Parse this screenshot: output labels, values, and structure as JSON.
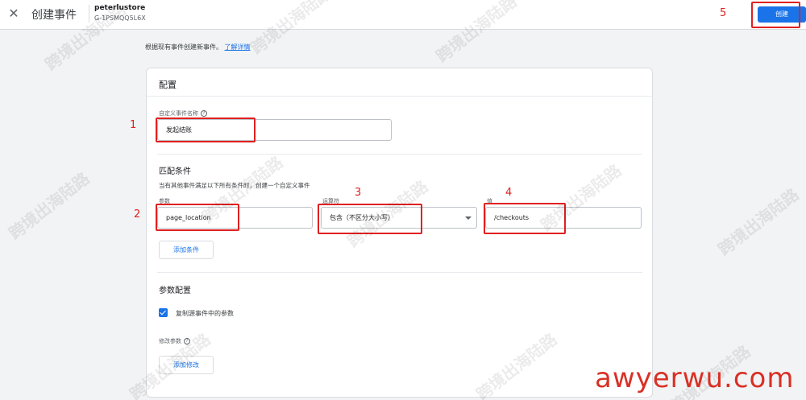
{
  "topbar": {
    "close_icon": "close-icon",
    "title": "创建事件",
    "property_name": "peterlustore",
    "property_id": "G-1PSMQQ5L6X",
    "create_label": "创建"
  },
  "intro": {
    "text": "根据现有事件创建新事件。",
    "link": "了解详情"
  },
  "config": {
    "title": "配置",
    "event_name_label": "自定义事件名称",
    "event_name_value": "发起结账"
  },
  "match": {
    "title": "匹配条件",
    "description": "当有其他事件满足以下所有条件时，创建一个自定义事件",
    "param_label": "参数",
    "param_value": "page_location",
    "operator_label": "运算符",
    "operator_value": "包含（不区分大小写）",
    "value_label": "值",
    "value_value": "/checkouts",
    "add_condition_label": "添加条件"
  },
  "param_config": {
    "title": "参数配置",
    "copy_params_label": "复制源事件中的参数",
    "copy_params_checked": true,
    "modify_params_label": "修改参数",
    "add_modify_label": "添加修改"
  },
  "annotations": [
    "1",
    "2",
    "3",
    "4",
    "5"
  ],
  "watermark": {
    "text": "跨境出海陆路",
    "site": "awyerwu.com"
  },
  "colors": {
    "primary": "#1a73e8",
    "annotation": "#e02020",
    "background": "#f1f3f4"
  }
}
